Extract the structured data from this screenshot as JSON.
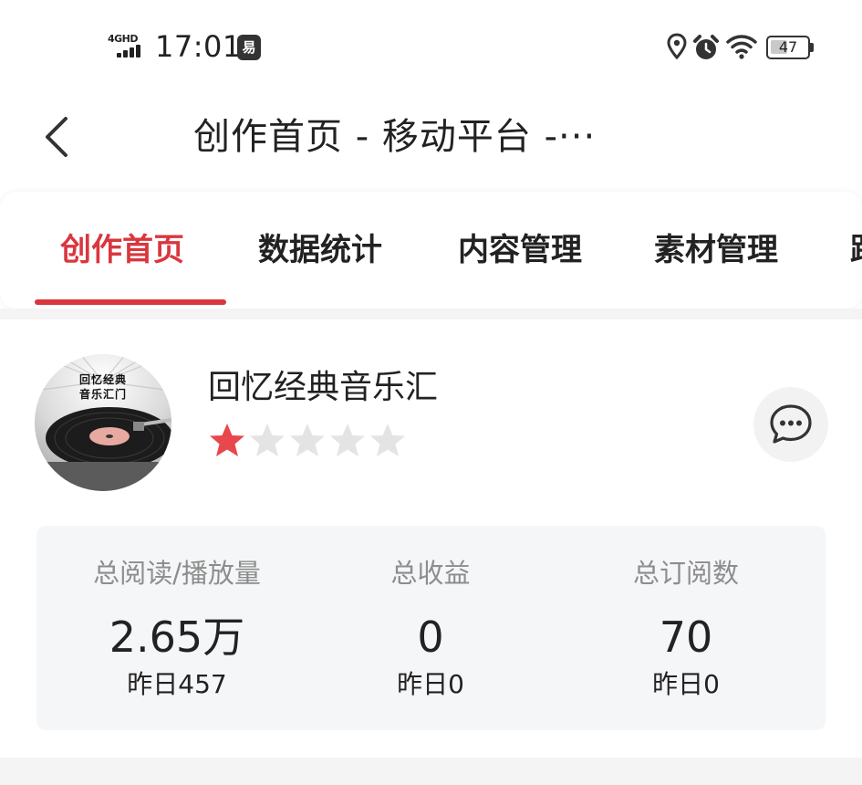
{
  "status_bar": {
    "network_type": "4GHD",
    "time": "17:01",
    "notification_icon_glyph": "易",
    "battery_level": "47",
    "icons": [
      "signal-icon",
      "location-icon",
      "alarm-icon",
      "wifi-icon",
      "battery-icon"
    ]
  },
  "header": {
    "title": "创作首页 - 移动平台 -···",
    "back_icon": "chevron-left-icon"
  },
  "tabs": [
    {
      "label": "创作首页",
      "active": true
    },
    {
      "label": "数据统计",
      "active": false
    },
    {
      "label": "内容管理",
      "active": false
    },
    {
      "label": "素材管理",
      "active": false
    },
    {
      "label": "跟",
      "active": false
    }
  ],
  "profile": {
    "avatar_caption": "回忆经典\n音乐汇门",
    "name": "回忆经典音乐汇",
    "rating": 1,
    "rating_max": 5,
    "message_icon": "chat-bubble-icon"
  },
  "stats": [
    {
      "label": "总阅读/播放量",
      "value": "2.65万",
      "yesterday": "昨日457"
    },
    {
      "label": "总收益",
      "value": "0",
      "yesterday": "昨日0"
    },
    {
      "label": "总订阅数",
      "value": "70",
      "yesterday": "昨日0"
    }
  ],
  "colors": {
    "accent": "#d9363e",
    "star_active": "#e8474b",
    "star_inactive": "#e4e4e4",
    "stats_background": "#f5f6f8"
  }
}
